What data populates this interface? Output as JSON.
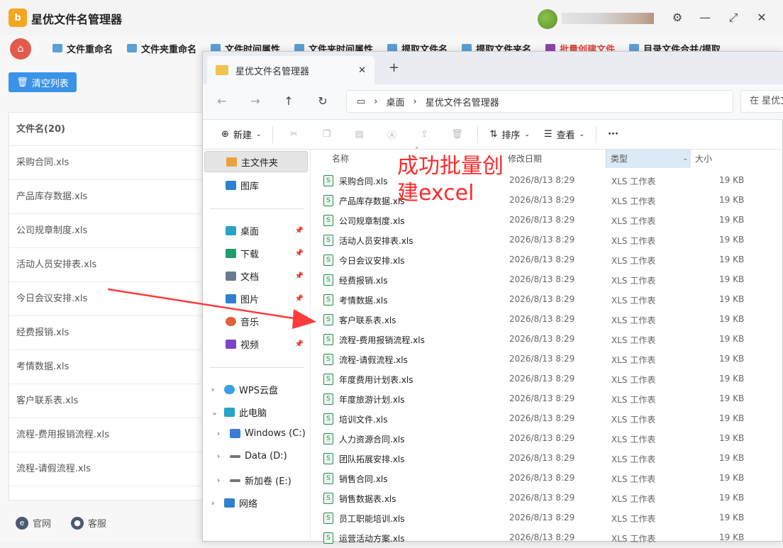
{
  "app": {
    "logo_text": "b",
    "title": "星优文件名管理器"
  },
  "window_controls": {
    "settings": "⚙",
    "minimize": "—",
    "maximize": "⤢",
    "close": "✕"
  },
  "nav_tabs": [
    {
      "label": "文件重命名",
      "icon": "file-rename-icon",
      "active": false
    },
    {
      "label": "文件夹重命名",
      "icon": "folder-rename-icon",
      "active": false
    },
    {
      "label": "文件时间属性",
      "icon": "file-time-icon",
      "active": false
    },
    {
      "label": "文件夹时间属性",
      "icon": "folder-time-icon",
      "active": false
    },
    {
      "label": "提取文件名",
      "icon": "extract-filename-icon",
      "active": false
    },
    {
      "label": "提取文件夹名",
      "icon": "extract-foldername-icon",
      "active": false
    },
    {
      "label": "批量创建文件",
      "icon": "batch-create-icon",
      "active": true
    },
    {
      "label": "目录文件合并/提取",
      "icon": "merge-icon",
      "active": false
    }
  ],
  "clear_button": "清空列表",
  "filelist": {
    "header": "文件名(20)",
    "items": [
      "采购合同.xls",
      "产品库存数据.xls",
      "公司规章制度.xls",
      "活动人员安排表.xls",
      "今日会议安排.xls",
      "经费报销.xls",
      "考情数据.xls",
      "客户联系表.xls",
      "流程-费用报销流程.xls",
      "流程-请假流程.xls"
    ]
  },
  "footer": {
    "website": "官网",
    "support": "客服"
  },
  "explorer": {
    "tab_title": "星优文件名管理器",
    "tab_close": "✕",
    "tab_add": "+",
    "breadcrumb": [
      "桌面",
      "星优文件名管理器"
    ],
    "breadcrumb_sep": "›",
    "search_placeholder": "在 星优文",
    "toolbar": {
      "new": "新建",
      "sort": "排序",
      "view": "查看",
      "more": "···"
    },
    "sidebar": {
      "home": "主文件夹",
      "gallery": "图库",
      "desktop": "桌面",
      "downloads": "下载",
      "documents": "文档",
      "pictures": "图片",
      "music": "音乐",
      "videos": "视频",
      "wps": "WPS云盘",
      "thispc": "此电脑",
      "drive_c": "Windows (C:)",
      "drive_d": "Data (D:)",
      "drive_e": "新加卷 (E:)",
      "network": "网络"
    },
    "columns": {
      "name": "名称",
      "modified": "修改日期",
      "type": "类型",
      "size": "大小"
    },
    "files": [
      {
        "name": "采购合同.xls",
        "date": "2026/8/13 8:29",
        "type": "XLS 工作表",
        "size": "19 KB"
      },
      {
        "name": "产品库存数据.xls",
        "date": "2026/8/13 8:29",
        "type": "XLS 工作表",
        "size": "19 KB"
      },
      {
        "name": "公司规章制度.xls",
        "date": "2026/8/13 8:29",
        "type": "XLS 工作表",
        "size": "19 KB"
      },
      {
        "name": "活动人员安排表.xls",
        "date": "2026/8/13 8:29",
        "type": "XLS 工作表",
        "size": "19 KB"
      },
      {
        "name": "今日会议安排.xls",
        "date": "2026/8/13 8:29",
        "type": "XLS 工作表",
        "size": "19 KB"
      },
      {
        "name": "经费报销.xls",
        "date": "2026/8/13 8:29",
        "type": "XLS 工作表",
        "size": "19 KB"
      },
      {
        "name": "考情数据.xls",
        "date": "2026/8/13 8:29",
        "type": "XLS 工作表",
        "size": "19 KB"
      },
      {
        "name": "客户联系表.xls",
        "date": "2026/8/13 8:29",
        "type": "XLS 工作表",
        "size": "19 KB"
      },
      {
        "name": "流程-费用报销流程.xls",
        "date": "2026/8/13 8:29",
        "type": "XLS 工作表",
        "size": "19 KB"
      },
      {
        "name": "流程-请假流程.xls",
        "date": "2026/8/13 8:29",
        "type": "XLS 工作表",
        "size": "19 KB"
      },
      {
        "name": "年度费用计划表.xls",
        "date": "2026/8/13 8:29",
        "type": "XLS 工作表",
        "size": "19 KB"
      },
      {
        "name": "年度旅游计划.xls",
        "date": "2026/8/13 8:29",
        "type": "XLS 工作表",
        "size": "19 KB"
      },
      {
        "name": "培训文件.xls",
        "date": "2026/8/13 8:29",
        "type": "XLS 工作表",
        "size": "19 KB"
      },
      {
        "name": "人力资源合同.xls",
        "date": "2026/8/13 8:29",
        "type": "XLS 工作表",
        "size": "19 KB"
      },
      {
        "name": "团队拓展安排.xls",
        "date": "2026/8/13 8:29",
        "type": "XLS 工作表",
        "size": "19 KB"
      },
      {
        "name": "销售合同.xls",
        "date": "2026/8/13 8:29",
        "type": "XLS 工作表",
        "size": "19 KB"
      },
      {
        "name": "销售数据表.xls",
        "date": "2026/8/13 8:29",
        "type": "XLS 工作表",
        "size": "19 KB"
      },
      {
        "name": "员工职能培训.xls",
        "date": "2026/8/13 8:29",
        "type": "XLS 工作表",
        "size": "19 KB"
      },
      {
        "name": "运营活动方案.xls",
        "date": "2026/8/13 8:29",
        "type": "XLS 工作表",
        "size": "19 KB"
      }
    ]
  },
  "annotation": {
    "line1": "成功批量创",
    "line2": "建excel",
    "color": "#ff2a2a"
  },
  "colors": {
    "accent": "#3b93e8",
    "active_tab": "#e0443a",
    "annotation": "#ff2a2a"
  }
}
